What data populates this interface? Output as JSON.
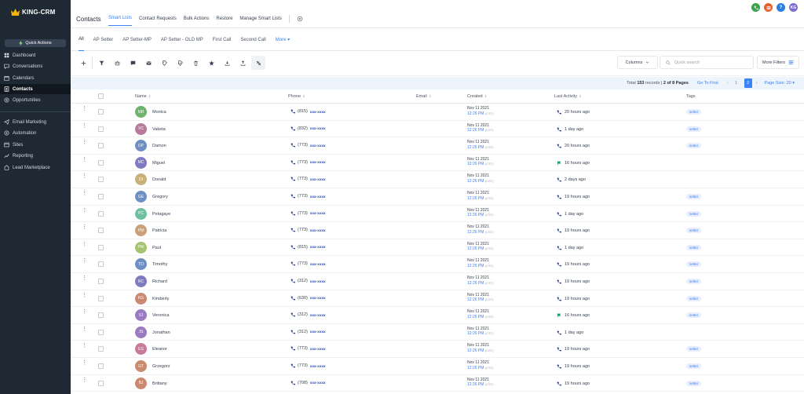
{
  "brand": {
    "name": "KING-CRM"
  },
  "sidebar": {
    "quick_actions": "Quick Actions",
    "items": [
      {
        "label": "Dashboard",
        "icon": "grid-icon"
      },
      {
        "label": "Conversations",
        "icon": "chat-icon"
      },
      {
        "label": "Calendars",
        "icon": "calendar-icon"
      },
      {
        "label": "Contacts",
        "icon": "contacts-icon",
        "active": true
      },
      {
        "label": "Opportunities",
        "icon": "opportunities-icon"
      },
      {
        "label": "Email Marketing",
        "icon": "email-marketing-icon"
      },
      {
        "label": "Automation",
        "icon": "automation-icon"
      },
      {
        "label": "Sites",
        "icon": "sites-icon"
      },
      {
        "label": "Reporting",
        "icon": "reporting-icon"
      },
      {
        "label": "Lead Marketplace",
        "icon": "marketplace-icon"
      }
    ]
  },
  "header": {
    "title": "Contacts",
    "tabs": [
      "Smart Lists",
      "Contact Requests",
      "Bulk Actions",
      "Restore",
      "Manage Smart Lists"
    ],
    "active_tab": "Smart Lists",
    "user_initials": "KG",
    "help_label": "?"
  },
  "list_tabs": [
    "All",
    "AP Setter",
    "AP Setter-MP",
    "AP Setter - OLD MP",
    "First Call",
    "Second Call"
  ],
  "list_more": "More",
  "toolbar": {
    "columns_label": "Columns",
    "search_placeholder": "Quick search",
    "more_filters_label": "More Filters"
  },
  "pagination": {
    "total_prefix": "Total",
    "total": "153",
    "total_suffix": "records |",
    "page_info": "2 of 8 Pages",
    "go_first": "Go To First",
    "pages": [
      "1",
      "2"
    ],
    "current": "2",
    "page_size": "Page Size: 20"
  },
  "table": {
    "columns": [
      "Name",
      "Phone",
      "Email",
      "Created",
      "Last Activity",
      "Tags"
    ],
    "rows": [
      {
        "initials": "MR",
        "color": "#6fb36f",
        "name": "Monica",
        "area": "(815)",
        "num": "xxx-xxxx",
        "date": "Nov 11 2021",
        "time": "12:26 PM",
        "tz": "(CST)",
        "activity": "20 hours ago",
        "act_type": "call",
        "tag": "setter"
      },
      {
        "initials": "VC",
        "color": "#b97a9b",
        "name": "Vaketa",
        "area": "(832)",
        "num": "xxx-xxxx",
        "date": "Nov 11 2021",
        "time": "12:26 PM",
        "tz": "(CST)",
        "activity": "1 day ago",
        "act_type": "call",
        "tag": "setter"
      },
      {
        "initials": "DP",
        "color": "#6f8fc4",
        "name": "Damon",
        "area": "(773)",
        "num": "xxx-xxxx",
        "date": "Nov 11 2021",
        "time": "12:26 PM",
        "tz": "(CST)",
        "activity": "20 hours ago",
        "act_type": "call",
        "tag": "setter"
      },
      {
        "initials": "MC",
        "color": "#7f7bc1",
        "name": "Miguel",
        "area": "(773)",
        "num": "xxx-xxxx",
        "date": "Nov 11 2021",
        "time": "12:26 PM",
        "tz": "(CST)",
        "activity": "16 hours ago",
        "act_type": "flag",
        "tag": ""
      },
      {
        "initials": "DI",
        "color": "#c9b07a",
        "name": "Donald",
        "area": "(773)",
        "num": "xxx-xxxx",
        "date": "Nov 11 2021",
        "time": "12:26 PM",
        "tz": "(CST)",
        "activity": "2 days ago",
        "act_type": "call",
        "tag": ""
      },
      {
        "initials": "GE",
        "color": "#6f8fc4",
        "name": "Gregory",
        "area": "(773)",
        "num": "xxx-xxxx",
        "date": "Nov 11 2021",
        "time": "12:26 PM",
        "tz": "(CST)",
        "activity": "19 hours ago",
        "act_type": "call",
        "tag": "setter"
      },
      {
        "initials": "PC",
        "color": "#6fc0a0",
        "name": "Petagaye",
        "area": "(773)",
        "num": "xxx-xxxx",
        "date": "Nov 11 2021",
        "time": "12:26 PM",
        "tz": "(CST)",
        "activity": "1 day ago",
        "act_type": "call",
        "tag": "setter"
      },
      {
        "initials": "PM",
        "color": "#c9a07a",
        "name": "Patricia",
        "area": "(773)",
        "num": "xxx-xxxx",
        "date": "Nov 11 2021",
        "time": "12:26 PM",
        "tz": "(CST)",
        "activity": "19 hours ago",
        "act_type": "call",
        "tag": "setter"
      },
      {
        "initials": "PW",
        "color": "#a4c46f",
        "name": "Paul",
        "area": "(815)",
        "num": "xxx-xxxx",
        "date": "Nov 11 2021",
        "time": "12:26 PM",
        "tz": "(CST)",
        "activity": "1 day ago",
        "act_type": "call",
        "tag": "setter"
      },
      {
        "initials": "TO",
        "color": "#6f8fc4",
        "name": "Timothy",
        "area": "(773)",
        "num": "xxx-xxxx",
        "date": "Nov 11 2021",
        "time": "12:26 PM",
        "tz": "(CST)",
        "activity": "19 hours ago",
        "act_type": "call",
        "tag": "setter"
      },
      {
        "initials": "RC",
        "color": "#7f7bc1",
        "name": "Richard",
        "area": "(312)",
        "num": "xxx-xxxx",
        "date": "Nov 11 2021",
        "time": "12:26 PM",
        "tz": "(CST)",
        "activity": "19 hours ago",
        "act_type": "call",
        "tag": "setter"
      },
      {
        "initials": "KG",
        "color": "#c98a6f",
        "name": "Kimberly",
        "area": "(630)",
        "num": "xxx-xxxx",
        "date": "Nov 11 2021",
        "time": "12:26 PM",
        "tz": "(CST)",
        "activity": "19 hours ago",
        "act_type": "call",
        "tag": "setter"
      },
      {
        "initials": "VJ",
        "color": "#9a7bc1",
        "name": "Veronica",
        "area": "(312)",
        "num": "xxx-xxxx",
        "date": "Nov 11 2021",
        "time": "12:26 PM",
        "tz": "(CST)",
        "activity": "16 hours ago",
        "act_type": "flag",
        "tag": "setter"
      },
      {
        "initials": "JS",
        "color": "#9a7bc1",
        "name": "Jonathan",
        "area": "(312)",
        "num": "xxx-xxxx",
        "date": "Nov 11 2021",
        "time": "12:26 PM",
        "tz": "(CST)",
        "activity": "1 day ago",
        "act_type": "call",
        "tag": ""
      },
      {
        "initials": "ES",
        "color": "#c97a9b",
        "name": "Eleanor",
        "area": "(773)",
        "num": "xxx-xxxx",
        "date": "Nov 11 2021",
        "time": "12:26 PM",
        "tz": "(CST)",
        "activity": "19 hours ago",
        "act_type": "call",
        "tag": "setter"
      },
      {
        "initials": "GT",
        "color": "#c98a6f",
        "name": "Grzegorz",
        "area": "(773)",
        "num": "xxx-xxxx",
        "date": "Nov 11 2021",
        "time": "12:26 PM",
        "tz": "(CST)",
        "activity": "19 hours ago",
        "act_type": "call",
        "tag": "setter"
      },
      {
        "initials": "BJ",
        "color": "#c98a6f",
        "name": "Brittany",
        "area": "(708)",
        "num": "xxx-xxxx",
        "date": "Nov 11 2021",
        "time": "12:26 PM",
        "tz": "(CST)",
        "activity": "19 hours ago",
        "act_type": "call",
        "tag": "setter"
      }
    ]
  }
}
